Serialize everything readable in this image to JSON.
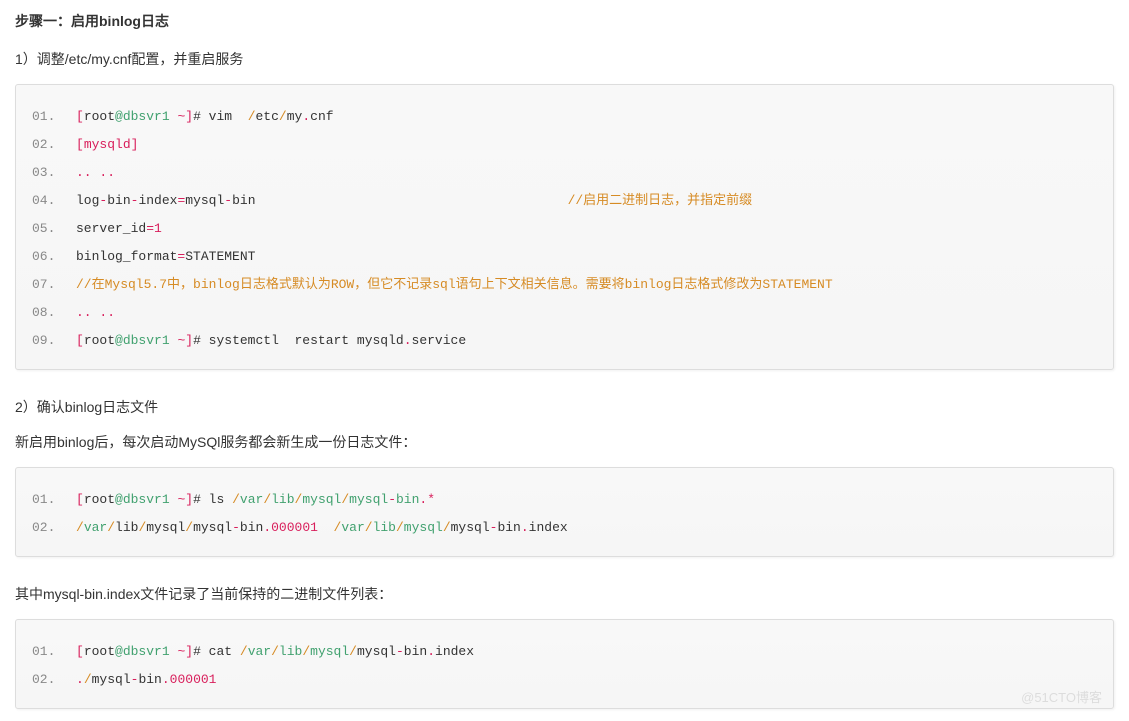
{
  "heading1": "步骤一：启用binlog日志",
  "para1": "1）调整/etc/my.cnf配置，并重启服务",
  "block1": {
    "lines": [
      [
        {
          "cls": "t-brack",
          "t": "["
        },
        {
          "cls": "",
          "t": "root"
        },
        {
          "cls": "t-at",
          "t": "@dbsvr1"
        },
        {
          "cls": "",
          "t": " "
        },
        {
          "cls": "t-tilde",
          "t": "~"
        },
        {
          "cls": "t-brack",
          "t": "]"
        },
        {
          "cls": "",
          "t": "# vim  "
        },
        {
          "cls": "t-sl",
          "t": "/"
        },
        {
          "cls": "",
          "t": "etc"
        },
        {
          "cls": "t-sl",
          "t": "/"
        },
        {
          "cls": "",
          "t": "my"
        },
        {
          "cls": "t-dot",
          "t": "."
        },
        {
          "cls": "",
          "t": "cnf"
        }
      ],
      [
        {
          "cls": "t-brack",
          "t": "["
        },
        {
          "cls": "t-kw",
          "t": "mysqld"
        },
        {
          "cls": "t-brack",
          "t": "]"
        }
      ],
      [
        {
          "cls": "t-ell",
          "t": ".. .."
        }
      ],
      [
        {
          "cls": "",
          "t": "log"
        },
        {
          "cls": "t-eq",
          "t": "-"
        },
        {
          "cls": "",
          "t": "bin"
        },
        {
          "cls": "t-eq",
          "t": "-"
        },
        {
          "cls": "",
          "t": "index"
        },
        {
          "cls": "t-eq",
          "t": "="
        },
        {
          "cls": "",
          "t": "mysql"
        },
        {
          "cls": "t-eq",
          "t": "-"
        },
        {
          "cls": "",
          "t": "bin"
        },
        {
          "cls": "",
          "t": "                                        "
        },
        {
          "cls": "t-comment-inline",
          "t": "//启用二进制日志，并指定前缀"
        }
      ],
      [
        {
          "cls": "",
          "t": "server_id"
        },
        {
          "cls": "t-eq",
          "t": "="
        },
        {
          "cls": "t-num",
          "t": "1"
        }
      ],
      [
        {
          "cls": "",
          "t": "binlog_format"
        },
        {
          "cls": "t-eq",
          "t": "="
        },
        {
          "cls": "",
          "t": "STATEMENT"
        }
      ],
      [
        {
          "cls": "t-comment-full",
          "t": "//在Mysql5.7中，binlog日志格式默认为ROW，但它不记录sql语句上下文相关信息。需要将binlog日志格式修改为STATEMENT"
        }
      ],
      [
        {
          "cls": "t-ell",
          "t": ".. .."
        }
      ],
      [
        {
          "cls": "t-brack",
          "t": "["
        },
        {
          "cls": "",
          "t": "root"
        },
        {
          "cls": "t-at",
          "t": "@dbsvr1"
        },
        {
          "cls": "",
          "t": " "
        },
        {
          "cls": "t-tilde",
          "t": "~"
        },
        {
          "cls": "t-brack",
          "t": "]"
        },
        {
          "cls": "",
          "t": "# systemctl  restart mysqld"
        },
        {
          "cls": "t-dot",
          "t": "."
        },
        {
          "cls": "",
          "t": "service"
        }
      ]
    ]
  },
  "para2": "2）确认binlog日志文件",
  "para3": "新启用binlog后，每次启动MySQl服务都会新生成一份日志文件：",
  "block2": {
    "lines": [
      [
        {
          "cls": "t-brack",
          "t": "["
        },
        {
          "cls": "",
          "t": "root"
        },
        {
          "cls": "t-at",
          "t": "@dbsvr1"
        },
        {
          "cls": "",
          "t": " "
        },
        {
          "cls": "t-tilde",
          "t": "~"
        },
        {
          "cls": "t-brack",
          "t": "]"
        },
        {
          "cls": "",
          "t": "# ls "
        },
        {
          "cls": "t-sl",
          "t": "/"
        },
        {
          "cls": "t-path",
          "t": "var"
        },
        {
          "cls": "t-sl",
          "t": "/"
        },
        {
          "cls": "t-path",
          "t": "lib"
        },
        {
          "cls": "t-sl",
          "t": "/"
        },
        {
          "cls": "t-path",
          "t": "mysql"
        },
        {
          "cls": "t-sl",
          "t": "/"
        },
        {
          "cls": "t-path",
          "t": "mysql"
        },
        {
          "cls": "t-eq",
          "t": "-"
        },
        {
          "cls": "t-path",
          "t": "bin"
        },
        {
          "cls": "t-dot",
          "t": "."
        },
        {
          "cls": "t-dot",
          "t": "*"
        }
      ],
      [
        {
          "cls": "t-sl",
          "t": "/"
        },
        {
          "cls": "t-path",
          "t": "var"
        },
        {
          "cls": "t-sl",
          "t": "/"
        },
        {
          "cls": "",
          "t": "lib"
        },
        {
          "cls": "t-sl",
          "t": "/"
        },
        {
          "cls": "",
          "t": "mysql"
        },
        {
          "cls": "t-sl",
          "t": "/"
        },
        {
          "cls": "",
          "t": "mysql"
        },
        {
          "cls": "t-eq",
          "t": "-"
        },
        {
          "cls": "",
          "t": "bin"
        },
        {
          "cls": "t-dot",
          "t": "."
        },
        {
          "cls": "t-num",
          "t": "000001"
        },
        {
          "cls": "",
          "t": "  "
        },
        {
          "cls": "t-sl",
          "t": "/"
        },
        {
          "cls": "t-path",
          "t": "var"
        },
        {
          "cls": "t-sl",
          "t": "/"
        },
        {
          "cls": "t-path",
          "t": "lib"
        },
        {
          "cls": "t-sl",
          "t": "/"
        },
        {
          "cls": "t-path",
          "t": "mysql"
        },
        {
          "cls": "t-sl",
          "t": "/"
        },
        {
          "cls": "",
          "t": "mysql"
        },
        {
          "cls": "t-eq",
          "t": "-"
        },
        {
          "cls": "",
          "t": "bin"
        },
        {
          "cls": "t-dot",
          "t": "."
        },
        {
          "cls": "",
          "t": "index"
        }
      ]
    ]
  },
  "para4": "其中mysql-bin.index文件记录了当前保持的二进制文件列表：",
  "block3": {
    "lines": [
      [
        {
          "cls": "t-brack",
          "t": "["
        },
        {
          "cls": "",
          "t": "root"
        },
        {
          "cls": "t-at",
          "t": "@dbsvr1"
        },
        {
          "cls": "",
          "t": " "
        },
        {
          "cls": "t-tilde",
          "t": "~"
        },
        {
          "cls": "t-brack",
          "t": "]"
        },
        {
          "cls": "",
          "t": "# cat "
        },
        {
          "cls": "t-sl",
          "t": "/"
        },
        {
          "cls": "t-path",
          "t": "var"
        },
        {
          "cls": "t-sl",
          "t": "/"
        },
        {
          "cls": "t-path",
          "t": "lib"
        },
        {
          "cls": "t-sl",
          "t": "/"
        },
        {
          "cls": "t-path",
          "t": "mysql"
        },
        {
          "cls": "t-sl",
          "t": "/"
        },
        {
          "cls": "",
          "t": "mysql"
        },
        {
          "cls": "t-eq",
          "t": "-"
        },
        {
          "cls": "",
          "t": "bin"
        },
        {
          "cls": "t-dot",
          "t": "."
        },
        {
          "cls": "",
          "t": "index"
        }
      ],
      [
        {
          "cls": "t-dot",
          "t": "."
        },
        {
          "cls": "t-sl",
          "t": "/"
        },
        {
          "cls": "",
          "t": "mysql"
        },
        {
          "cls": "t-eq",
          "t": "-"
        },
        {
          "cls": "",
          "t": "bin"
        },
        {
          "cls": "t-dot",
          "t": "."
        },
        {
          "cls": "t-num",
          "t": "000001"
        }
      ]
    ]
  },
  "watermark": "@51CTO博客"
}
